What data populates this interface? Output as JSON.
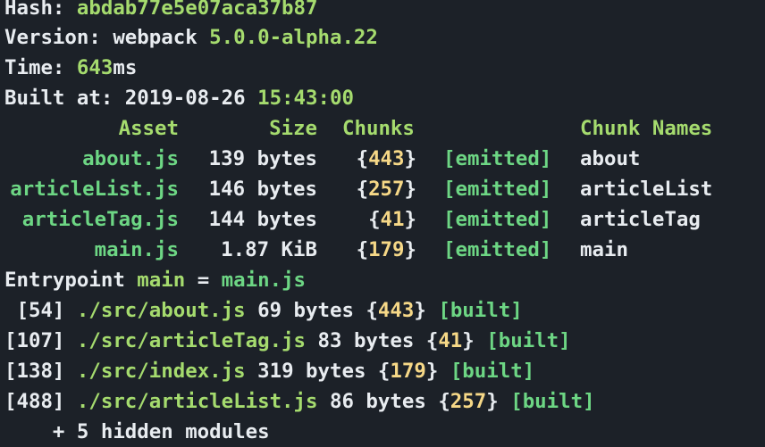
{
  "header": {
    "hash_label": "Hash: ",
    "hash_value": "abdab77e5e07aca37b87",
    "version_label": "Version: webpack ",
    "version_value": "5.0.0-alpha.22",
    "time_label": "Time: ",
    "time_value": "643",
    "time_unit": "ms",
    "built_label": "Built at: 2019-08-26 ",
    "built_time": "15:43:00"
  },
  "assets_table": {
    "headers": {
      "asset": "Asset",
      "size": "Size",
      "chunks": "Chunks",
      "chunk_names": "Chunk Names"
    },
    "rows": [
      {
        "asset": "about.js",
        "size": "139 bytes",
        "chunk": "443",
        "status": "[emitted]",
        "name": "about"
      },
      {
        "asset": "articleList.js",
        "size": "146 bytes",
        "chunk": "257",
        "status": "[emitted]",
        "name": "articleList"
      },
      {
        "asset": "articleTag.js",
        "size": "144 bytes",
        "chunk": "41",
        "status": "[emitted]",
        "name": "articleTag"
      },
      {
        "asset": "main.js",
        "size": "1.87 KiB",
        "chunk": "179",
        "status": "[emitted]",
        "name": "main"
      }
    ]
  },
  "entrypoint": {
    "label": "Entrypoint ",
    "name": "main",
    "eq": " = ",
    "file": "main.js"
  },
  "modules": [
    {
      "id": " [54] ",
      "path": "./src/about.js",
      "size": " 69 bytes ",
      "chunk": "443",
      "status": "[built]"
    },
    {
      "id": "[107] ",
      "path": "./src/articleTag.js",
      "size": " 83 bytes ",
      "chunk": "41",
      "status": "[built]"
    },
    {
      "id": "[138] ",
      "path": "./src/index.js",
      "size": " 319 bytes ",
      "chunk": "179",
      "status": "[built]"
    },
    {
      "id": "[488] ",
      "path": "./src/articleList.js",
      "size": " 86 bytes ",
      "chunk": "257",
      "status": "[built]"
    }
  ],
  "hidden_modules": "    + 5 hidden modules",
  "colors": {
    "background": "#1c2128",
    "text": "#e8ecf0",
    "green": "#a5db6e",
    "bright_green": "#6dd684",
    "yellow": "#f6d887"
  }
}
